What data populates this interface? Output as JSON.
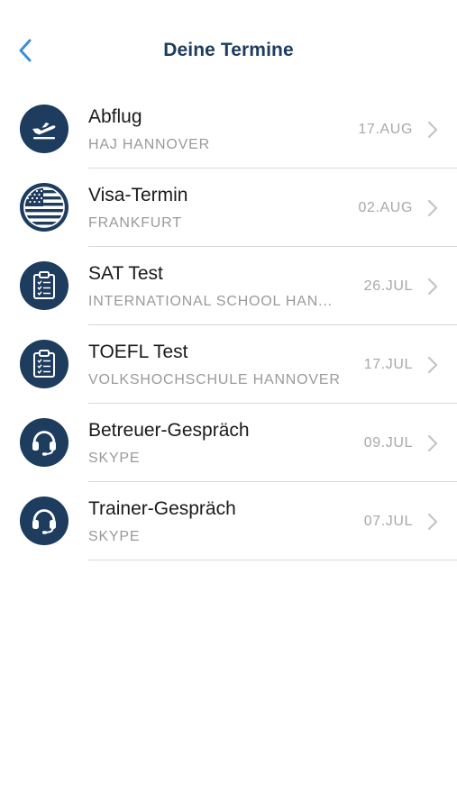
{
  "header": {
    "title": "Deine Termine",
    "back_icon": "chevron-left-icon",
    "accent": "#3b8fd6"
  },
  "colors": {
    "icon_bg": "#1d3c5e",
    "title": "#1d3c5e",
    "subtitle": "#9a9a9a"
  },
  "appointments": [
    {
      "title": "Abflug",
      "subtitle": "HAJ HANNOVER",
      "date": "17.AUG",
      "icon": "airplane-departure-icon"
    },
    {
      "title": "Visa-Termin",
      "subtitle": "FRANKFURT",
      "date": "02.AUG",
      "icon": "us-flag-icon"
    },
    {
      "title": "SAT Test",
      "subtitle": "INTERNATIONAL SCHOOL HAN...",
      "date": "26.JUL",
      "icon": "clipboard-checklist-icon"
    },
    {
      "title": "TOEFL Test",
      "subtitle": "VOLKSHOCHSCHULE HANNOVER",
      "date": "17.JUL",
      "icon": "clipboard-checklist-icon"
    },
    {
      "title": "Betreuer-Gespräch",
      "subtitle": "SKYPE",
      "date": "09.JUL",
      "icon": "headset-icon"
    },
    {
      "title": "Trainer-Gespräch",
      "subtitle": "SKYPE",
      "date": "07.JUL",
      "icon": "headset-icon"
    }
  ]
}
